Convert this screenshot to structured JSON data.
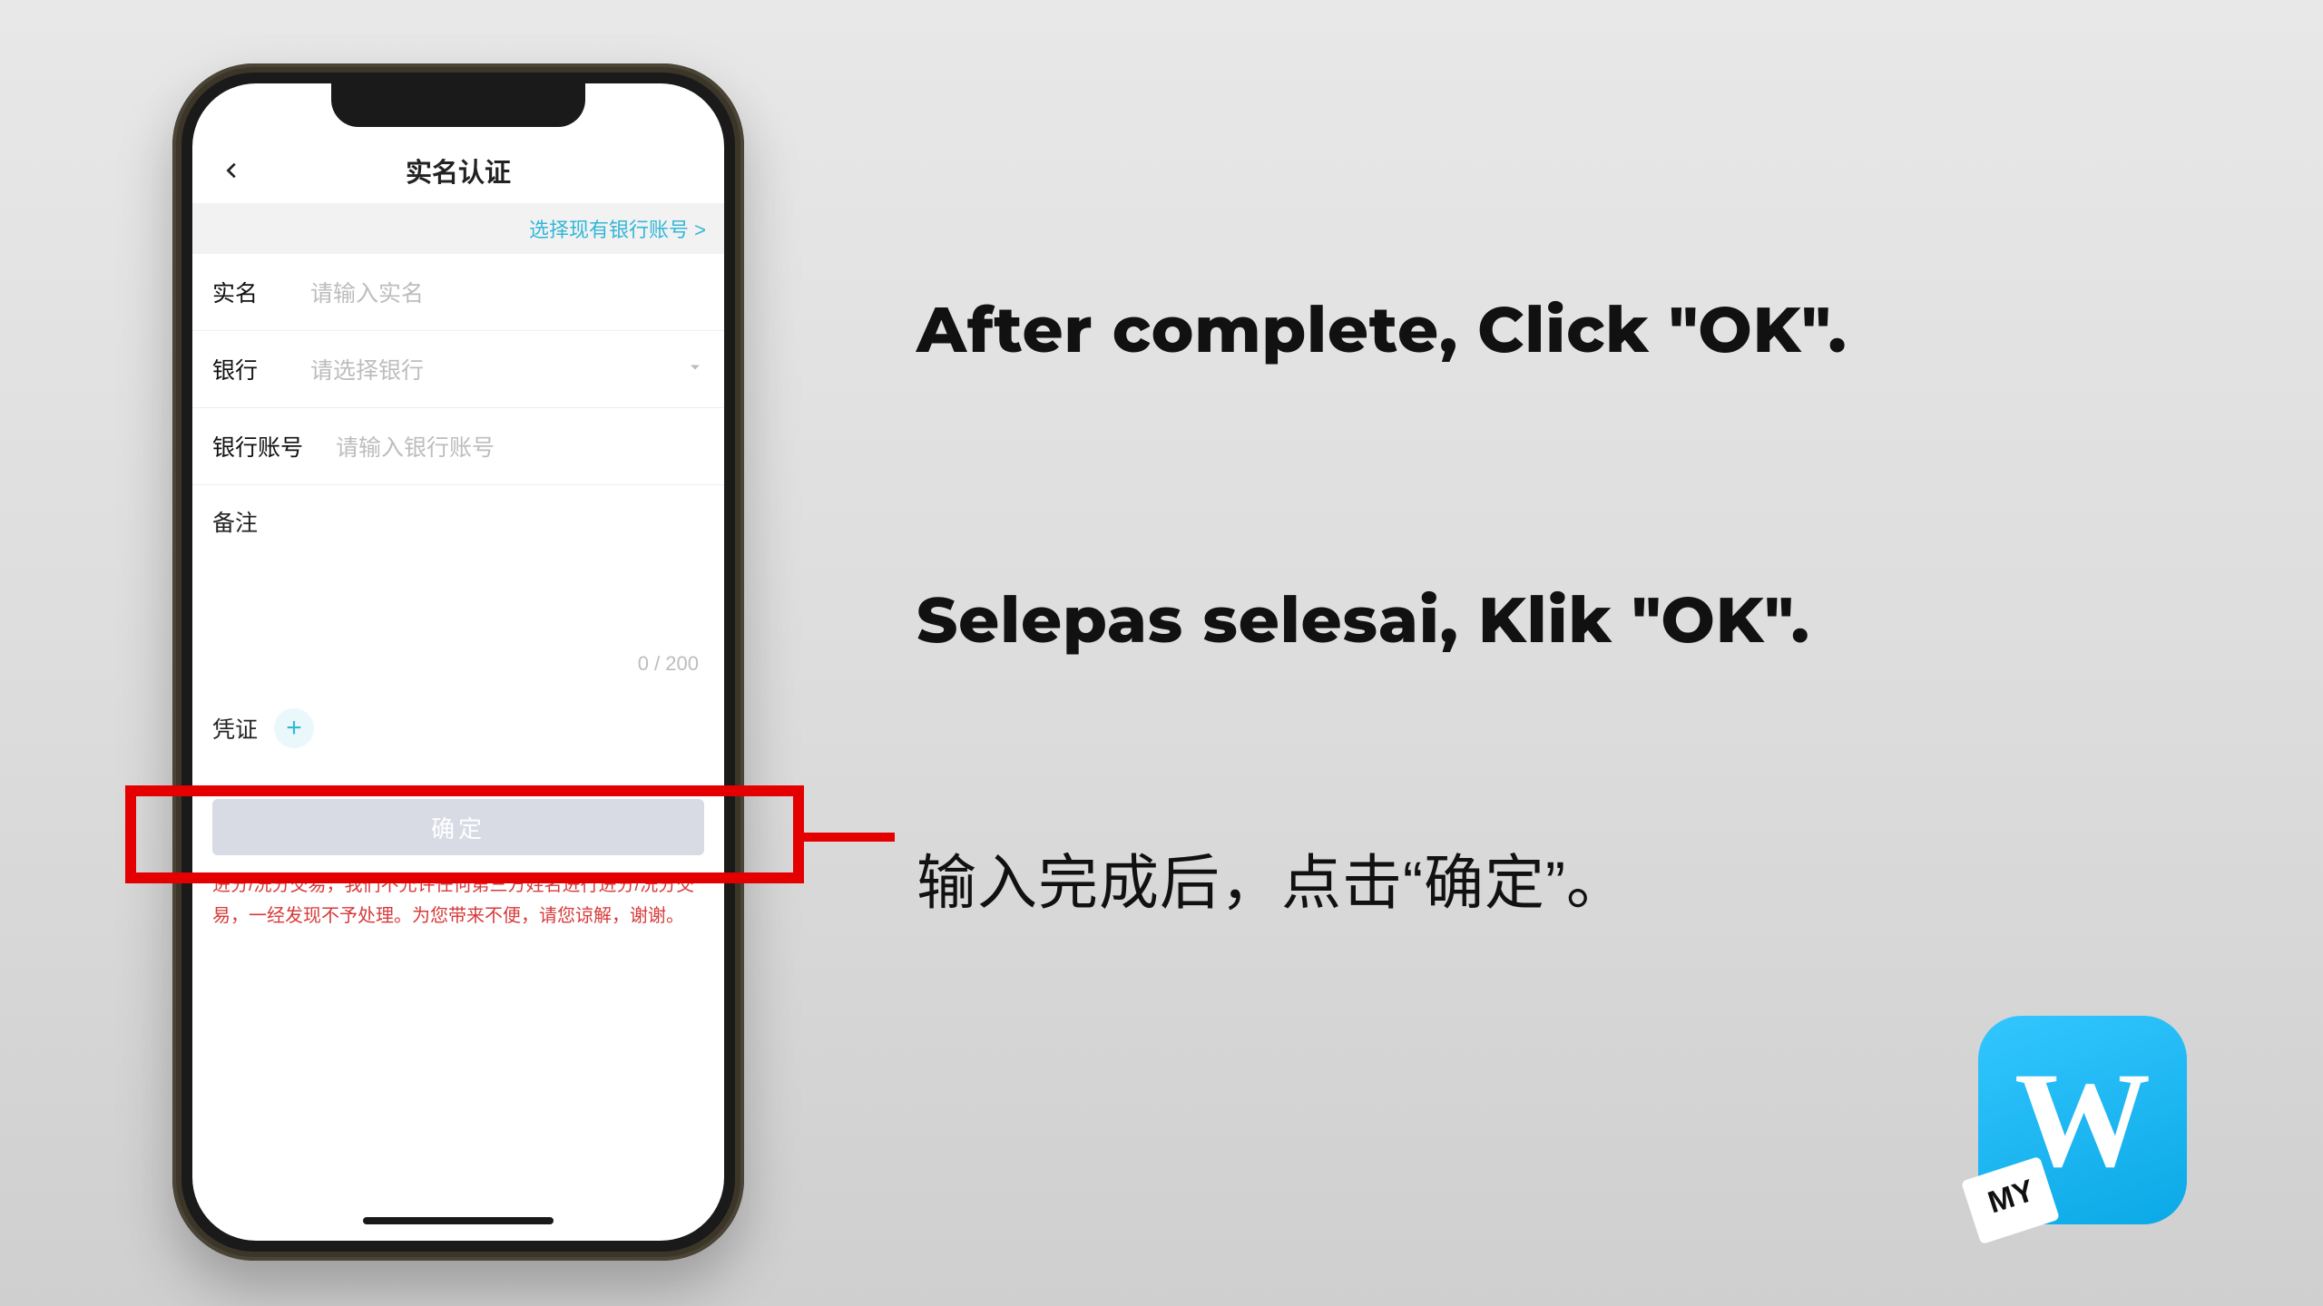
{
  "phone": {
    "title": "实名认证",
    "select_existing_link": "选择现有银行账号 >",
    "fields": {
      "realname_label": "实名",
      "realname_placeholder": "请输入实名",
      "bank_label": "银行",
      "bank_placeholder": "请选择银行",
      "account_label": "银行账号",
      "account_placeholder": "请输入银行账号",
      "memo_label": "备注",
      "memo_counter": "0 / 200",
      "voucher_label": "凭证"
    },
    "submit_label": "确定",
    "warning": "进分/洗分交易，我们不允许任何第三方姓名进行进分/洗分交易，一经发现不予处理。为您带来不便，请您谅解，谢谢。"
  },
  "instructions": {
    "en": "After complete, Click \"OK\".",
    "ms": "Selepas selesai, Klik \"OK\".",
    "zh": "输入完成后，点击“确定”。"
  },
  "badge": {
    "letter": "W",
    "corner": "MY"
  }
}
